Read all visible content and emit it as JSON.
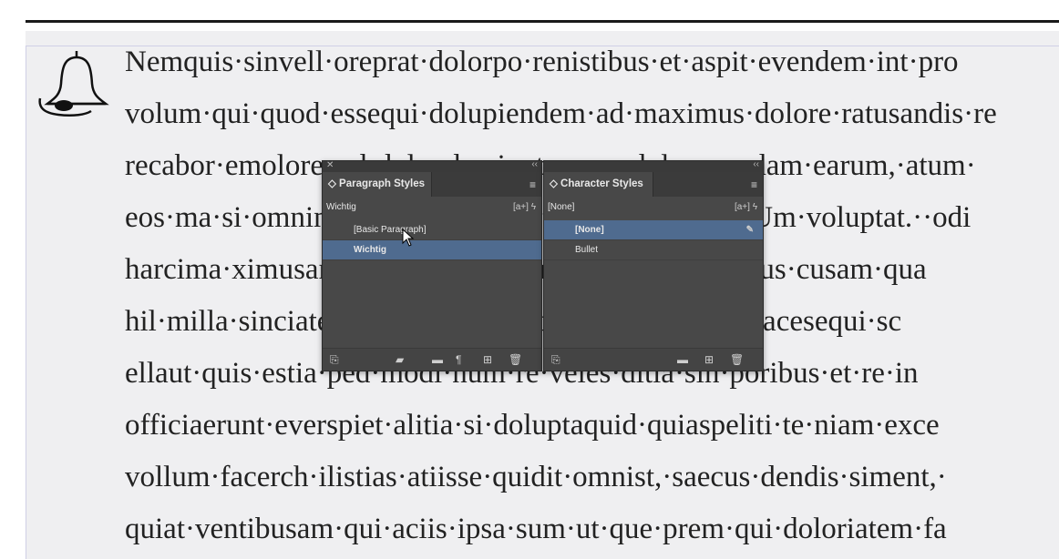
{
  "document": {
    "lines": [
      "Nemquis·sinvell·oreprat·dolorpo·renistibus·et·aspit·evendem·int·pro",
      "volum·qui·quod·essequi·dolupiendem·ad·maximus·dolore·ratusandis·re",
      "recabor·emoloreped·dolupdaeriunt·quam·dolupmendam·earum,·atum·",
      "eos·ma·si·omnimagnam·aut·voluptatem·nobitatur?·Um·voluptat.··odi",
      "harcima·ximusanda·ut·accusda·commodit·milliaeribus·cusam·qua",
      "hil·milla·sinciate·ventiorem·qui·dolupta·exceped·ut·acesequi·sc",
      "ellaut·quis·estia·ped·modi·num·re·veles·ditia·sin·poribus·et·re·in",
      "officiaerunt·everspiet·alitia·si·doluptaquid·quiaspeliti·te·niam·exce",
      "vollum·facerch·ilistias·atiisse·quidit·omnist,·saecus·dendis·siment,·",
      "quiat·ventibusam·qui·aciis·ipsa·sum·ut·que·prem·qui·doloriatem·fa"
    ]
  },
  "paragraph_styles": {
    "title": "Paragraph Styles",
    "current": "Wichtig",
    "current_icons": "[a+]  ϟ",
    "items": [
      {
        "label": "[Basic Paragraph]"
      },
      {
        "label": "Wichtig"
      }
    ]
  },
  "character_styles": {
    "title": "Character Styles",
    "current": "[None]",
    "current_icons": "[a+]  ϟ",
    "items": [
      {
        "label": "[None]"
      },
      {
        "label": "Bullet"
      }
    ]
  },
  "colors": {
    "panel_bg": "#484848",
    "selection": "#4f6b8f",
    "frame_bg": "#efeff1"
  }
}
